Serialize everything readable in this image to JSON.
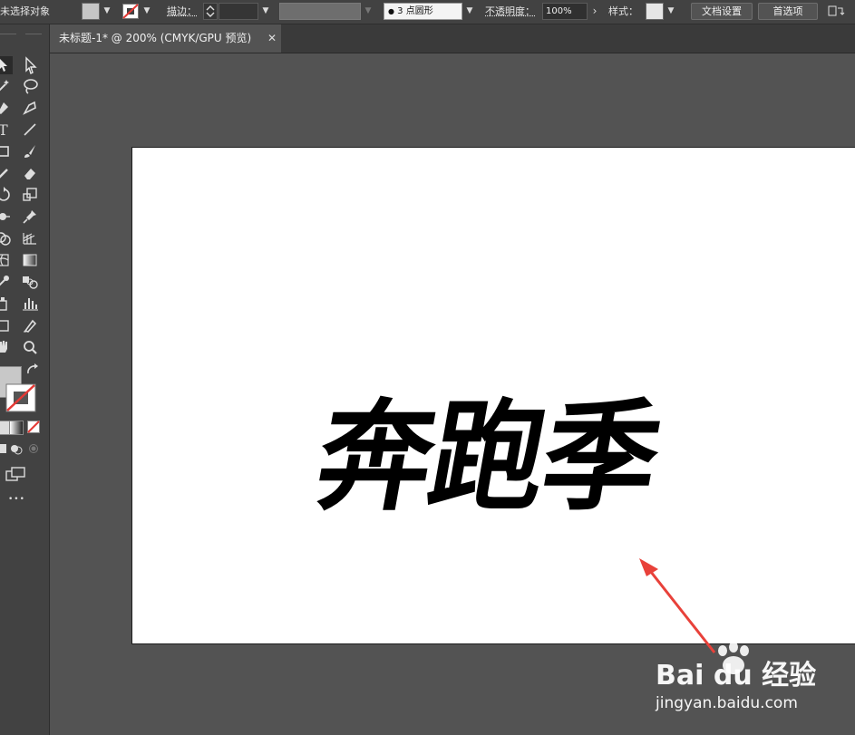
{
  "control_bar": {
    "selection_status": "未选择对象",
    "stroke_label": "描边：",
    "brush_label": "3 点圆形",
    "opacity_label": "不透明度：",
    "opacity_value": "100%",
    "style_label": "样式：",
    "document_setup_button": "文档设置",
    "preferences_button": "首选项"
  },
  "document_tab": {
    "title": "未标题-1* @ 200% (CMYK/GPU 预览)",
    "close_glyph": "✕"
  },
  "artboard": {
    "text": "奔跑季"
  },
  "toolbar": {
    "more_tools_glyph": "•••"
  },
  "watermark": {
    "main": "Bai du 经验",
    "sub": "jingyan.baidu.com"
  },
  "colors": {
    "annotation_arrow": "#e8413a",
    "canvas_background": "#535353",
    "panel_background": "#424242"
  }
}
